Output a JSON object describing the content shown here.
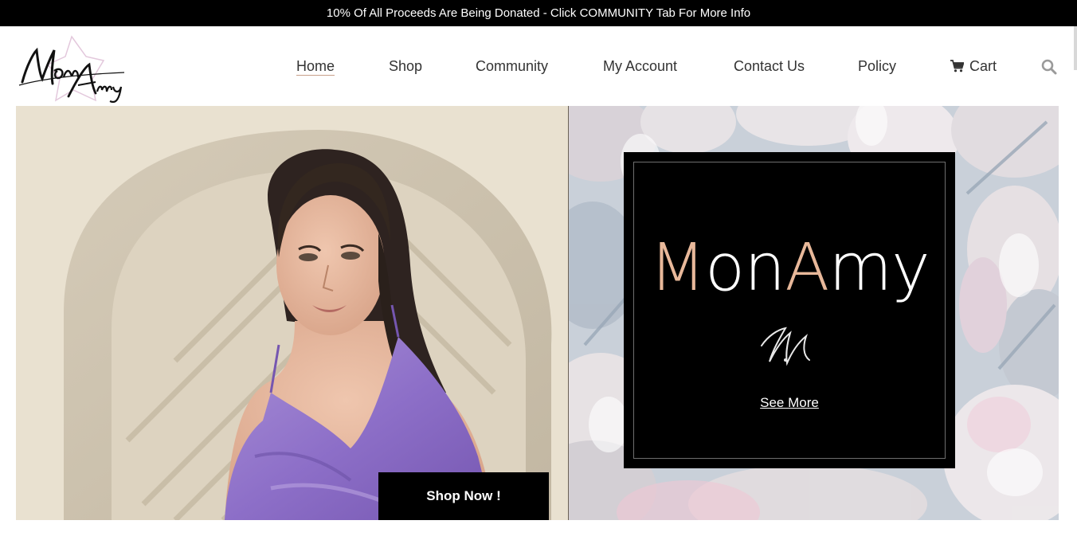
{
  "announcement": "10% Of All Proceeds Are Being Donated - Click COMMUNITY Tab For More Info",
  "logo": {
    "text": "MonAmy"
  },
  "nav": {
    "items": [
      {
        "label": "Home",
        "active": true
      },
      {
        "label": "Shop"
      },
      {
        "label": "Community"
      },
      {
        "label": "My Account"
      },
      {
        "label": "Contact Us"
      },
      {
        "label": "Policy"
      },
      {
        "label": "Cart",
        "icon": "cart-icon"
      }
    ],
    "search_icon": "search-icon"
  },
  "hero_left": {
    "button_label": "Shop Now !"
  },
  "hero_right": {
    "brand_parts": [
      "M",
      "on",
      "A",
      "my"
    ],
    "mark": "M",
    "link_label": "See More"
  },
  "colors": {
    "announcement_bg": "#000000",
    "accent_peach": "#e8b89a",
    "nav_text": "#333333",
    "brand_box_bg": "#000000"
  }
}
